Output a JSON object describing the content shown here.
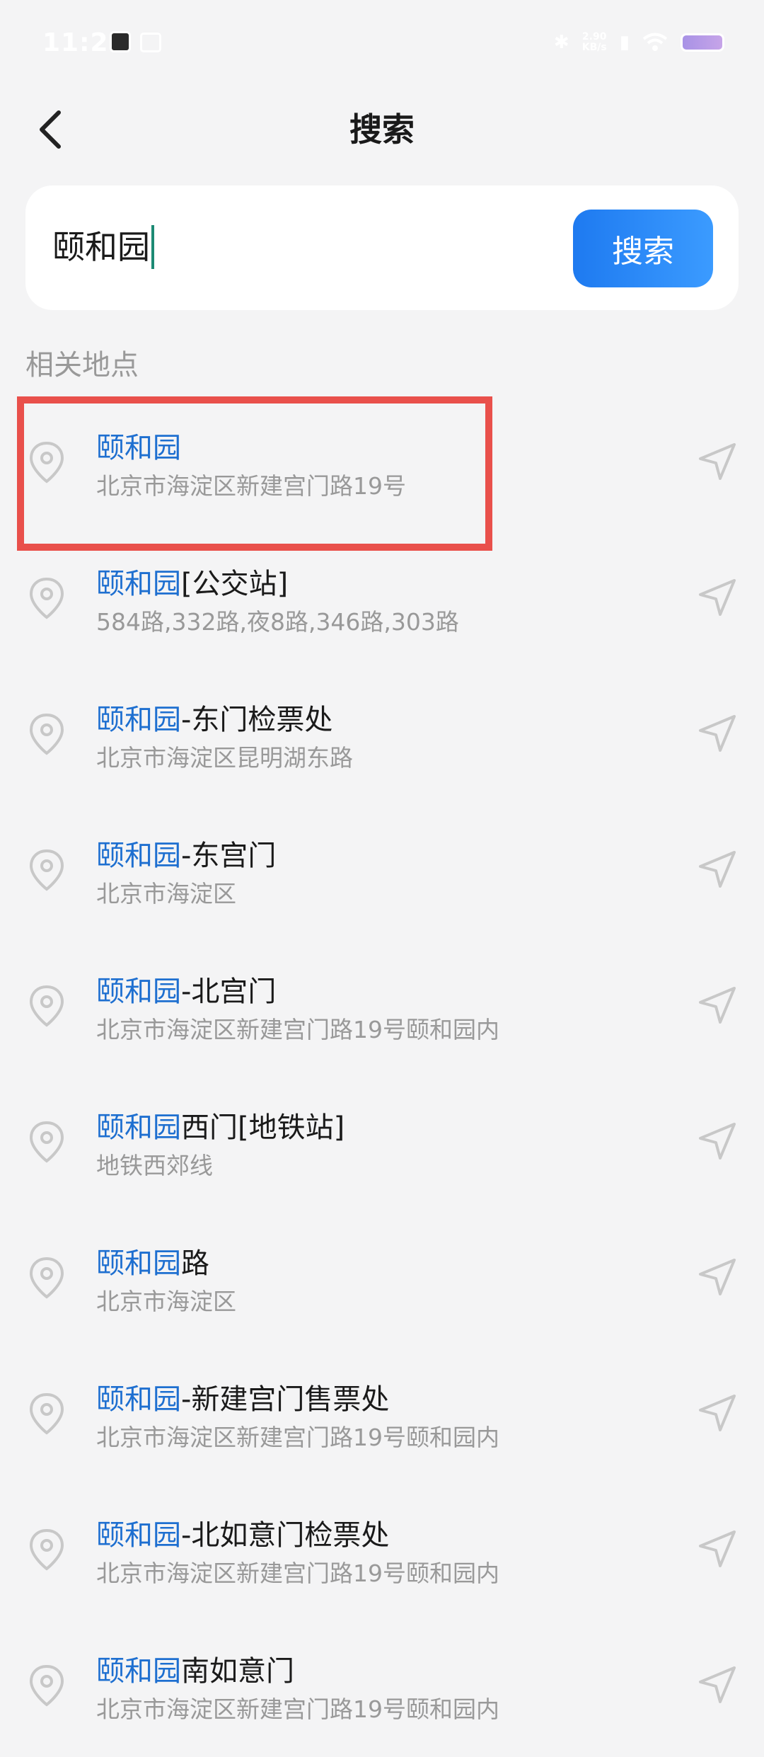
{
  "status_bar": {
    "time": "11:29",
    "speed_value": "2.90",
    "speed_unit": "KB/s",
    "icons": [
      "avatar-icon",
      "gallery-icon",
      "bluetooth-icon",
      "sim-icon",
      "wifi-icon",
      "battery-icon"
    ]
  },
  "header": {
    "title": "搜索"
  },
  "search": {
    "query": "颐和园",
    "button_label": "搜索"
  },
  "section_label": "相关地点",
  "colors": {
    "highlight": "#1e6fd0",
    "accent_button": "#1e7af0",
    "annotation_box": "#e9504b"
  },
  "results": [
    {
      "highlight": "颐和园",
      "suffix": "",
      "address": "北京市海淀区新建宫门路19号"
    },
    {
      "highlight": "颐和园",
      "suffix": "[公交站]",
      "address": "584路,332路,夜8路,346路,303路"
    },
    {
      "highlight": "颐和园",
      "suffix": "-东门检票处",
      "address": "北京市海淀区昆明湖东路"
    },
    {
      "highlight": "颐和园",
      "suffix": "-东宫门",
      "address": "北京市海淀区"
    },
    {
      "highlight": "颐和园",
      "suffix": "-北宫门",
      "address": "北京市海淀区新建宫门路19号颐和园内"
    },
    {
      "highlight": "颐和园",
      "suffix": "西门[地铁站]",
      "address": "地铁西郊线"
    },
    {
      "highlight": "颐和园",
      "suffix": "路",
      "address": "北京市海淀区"
    },
    {
      "highlight": "颐和园",
      "suffix": "-新建宫门售票处",
      "address": "北京市海淀区新建宫门路19号颐和园内"
    },
    {
      "highlight": "颐和园",
      "suffix": "-北如意门检票处",
      "address": "北京市海淀区新建宫门路19号颐和园内"
    },
    {
      "highlight": "颐和园",
      "suffix": "南如意门",
      "address": "北京市海淀区新建宫门路19号颐和园内"
    }
  ]
}
